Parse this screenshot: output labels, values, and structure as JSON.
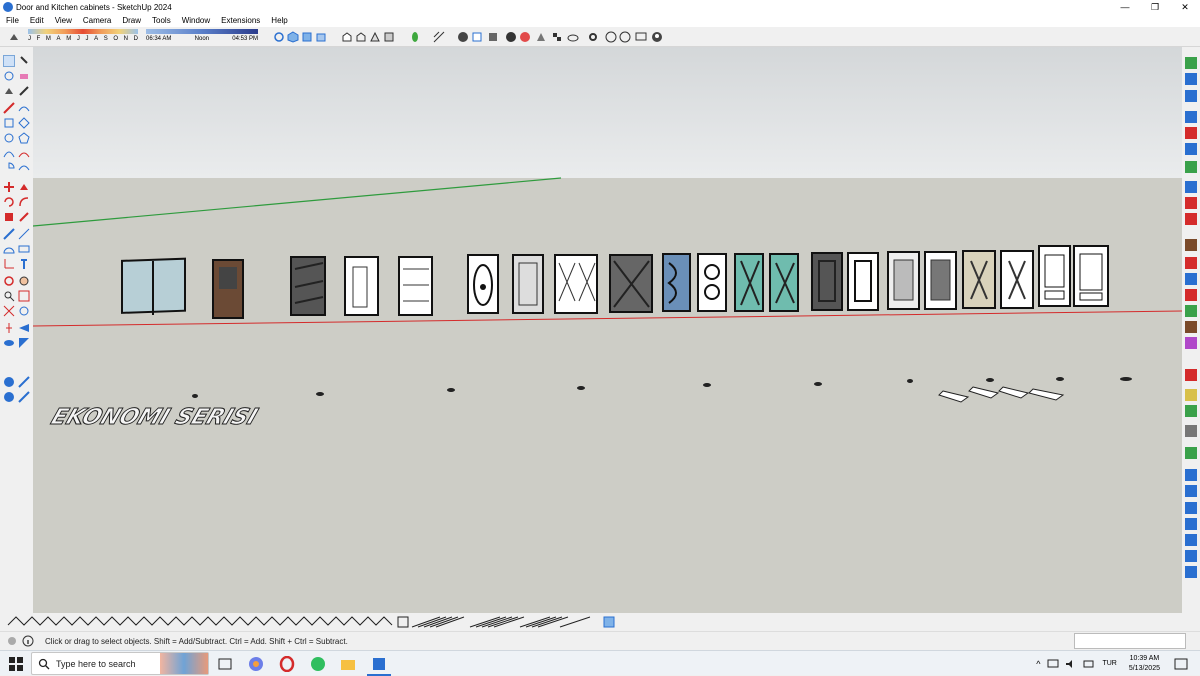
{
  "window": {
    "title": "Door and Kitchen cabinets - SketchUp 2024",
    "minimize": "—",
    "restore": "❐",
    "close": "✕"
  },
  "menu": [
    "File",
    "Edit",
    "View",
    "Camera",
    "Draw",
    "Tools",
    "Window",
    "Extensions",
    "Help"
  ],
  "shadow_settings": {
    "months": [
      "J",
      "F",
      "M",
      "A",
      "M",
      "J",
      "J",
      "A",
      "S",
      "O",
      "N",
      "D"
    ],
    "time_start": "06:34 AM",
    "time_mid": "Noon",
    "time_end": "04:53 PM"
  },
  "model_text": "EKONOMI SERISI",
  "status": {
    "hint": "Click or drag to select objects. Shift = Add/Subtract. Ctrl = Add. Shift + Ctrl = Subtract."
  },
  "taskbar": {
    "search_placeholder": "Type here to search",
    "language": "TUR",
    "time": "10:39 AM",
    "date": "5/13/2025"
  },
  "colors": {
    "ground": "#cdcdc6",
    "sky": "#e6e8e9",
    "axis_red": "#d42b2b",
    "axis_green": "#2e9b3d",
    "accent": "#2a6fd0"
  }
}
